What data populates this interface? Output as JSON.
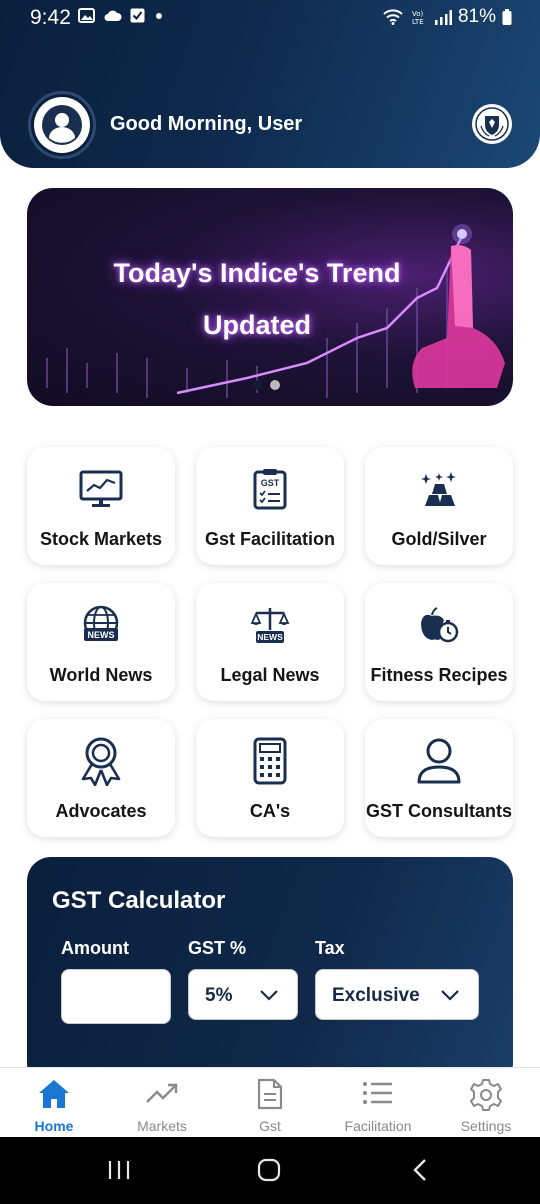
{
  "status": {
    "time": "9:42",
    "battery": "81%"
  },
  "header": {
    "greeting": "Good Morning, User"
  },
  "banner": {
    "line1": "Today's Indice's Trend",
    "line2": "Updated",
    "slide_count": 2,
    "active_slide": 1
  },
  "services": [
    {
      "label": "Stock Markets",
      "icon": "monitor-chart-icon"
    },
    {
      "label": "Gst Facilitation",
      "icon": "gst-document-icon"
    },
    {
      "label": "Gold/Silver",
      "icon": "gold-bars-icon"
    },
    {
      "label": "World News",
      "icon": "globe-news-icon"
    },
    {
      "label": "Legal News",
      "icon": "scales-news-icon"
    },
    {
      "label": "Fitness Recipes",
      "icon": "apple-timer-icon"
    },
    {
      "label": "Advocates",
      "icon": "award-ribbon-icon"
    },
    {
      "label": "CA's",
      "icon": "calculator-icon"
    },
    {
      "label": "GST Consultants",
      "icon": "person-icon"
    }
  ],
  "calculator": {
    "title": "GST Calculator",
    "amount_label": "Amount",
    "amount_value": "",
    "gst_label": "GST %",
    "gst_value": "5%",
    "tax_label": "Tax",
    "tax_value": "Exclusive"
  },
  "bottom_nav": [
    {
      "label": "Home",
      "icon": "home-icon",
      "active": true
    },
    {
      "label": "Markets",
      "icon": "trend-icon",
      "active": false
    },
    {
      "label": "Gst",
      "icon": "document-icon",
      "active": false
    },
    {
      "label": "Facilitation",
      "icon": "list-icon",
      "active": false
    },
    {
      "label": "Settings",
      "icon": "gear-icon",
      "active": false
    }
  ],
  "colors": {
    "accent": "#1976d2",
    "header_dark": "#0a1f3c",
    "icon_navy": "#1a2f4f"
  }
}
